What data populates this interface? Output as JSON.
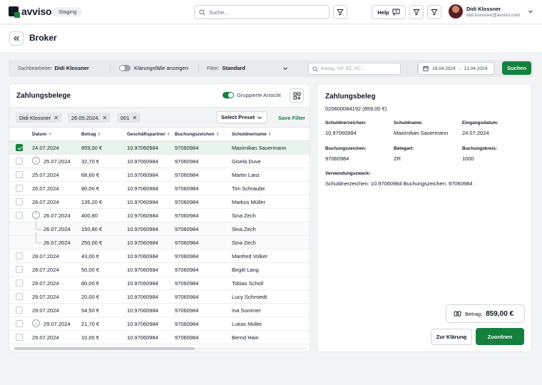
{
  "header": {
    "logo_text": "avviso",
    "env_badge": "Staging",
    "search_placeholder": "Suche...",
    "help_label": "Help",
    "user_name": "Didi Klossner",
    "user_email": "didi.klossner@avviso.com"
  },
  "page": {
    "title": "Broker"
  },
  "filterbar": {
    "clerk_label": "Sachbearbeiter",
    "clerk_value": "Didi Klossner",
    "clarification_toggle_label": "Klärungsfälle anzeigen",
    "clarification_toggle_on": false,
    "filter_label": "Filter:",
    "filter_value": "Standard",
    "search_placeholder": "Betrag, GP, BZ, SC...",
    "date_from": "18.04.2024",
    "date_sep": "-",
    "date_to": "21.04.2024",
    "search_button": "Suchen"
  },
  "left": {
    "title": "Zahlungsbelege",
    "grouped_label": "Gruppierte Ansicht",
    "grouped_on": true,
    "chips": [
      "Didi Klossner",
      "26.05.2024.",
      "001"
    ],
    "preset_label": "Select Preset",
    "save_filter": "Save Filter",
    "columns": [
      "Datum",
      "Betrag",
      "Geschäftspartner",
      "Buchungszeichen",
      "Schuldnername"
    ],
    "rows": [
      {
        "date": "24.07.2024",
        "amount": "859,00 €",
        "partner": "10.97060984",
        "booking": "97060984",
        "name": "Maximilian Sauermann",
        "kind": "normal",
        "checked": true,
        "selected": true
      },
      {
        "date": "25.07.2024",
        "amount": "32,70 €",
        "partner": "10.97060984",
        "booking": "97060984",
        "name": "Gisela Duve",
        "kind": "group-collapsed",
        "checked": false,
        "selected": false
      },
      {
        "date": "25.07.2024",
        "amount": "68,60 €",
        "partner": "10.97060984",
        "booking": "97060984",
        "name": "Martin Lanz",
        "kind": "normal",
        "checked": false,
        "selected": false
      },
      {
        "date": "26.07.2024",
        "amount": "80,00 €",
        "partner": "10.97060984",
        "booking": "97060984",
        "name": "Tim Schraube",
        "kind": "normal",
        "checked": false,
        "selected": false
      },
      {
        "date": "26.07.2024",
        "amount": "135,20 €",
        "partner": "10.97060984",
        "booking": "97060984",
        "name": "Markus Müller",
        "kind": "normal",
        "checked": false,
        "selected": false
      },
      {
        "date": "26.07.2024",
        "amount": "400,80",
        "partner": "10.97060984",
        "booking": "97060984",
        "name": "Sina Zech",
        "kind": "group-expanded",
        "checked": false,
        "selected": false
      },
      {
        "date": "26.07.2024",
        "amount": "150,80 €",
        "partner": "10.97060984",
        "booking": "97060984",
        "name": "Sina Zech",
        "kind": "child",
        "checked": false,
        "selected": false
      },
      {
        "date": "26.07.2024",
        "amount": "250,00 €",
        "partner": "10.97060984",
        "booking": "97060984",
        "name": "Sina Zech",
        "kind": "child-last",
        "checked": false,
        "selected": false
      },
      {
        "date": "28.07.2024",
        "amount": "43,00 €",
        "partner": "10.97060984",
        "booking": "97060984",
        "name": "Manfred Volker",
        "kind": "normal",
        "checked": false,
        "selected": false
      },
      {
        "date": "28.07.2024",
        "amount": "50,00 €",
        "partner": "10.97060984",
        "booking": "97060984",
        "name": "Birgitt Lang",
        "kind": "normal",
        "checked": false,
        "selected": false
      },
      {
        "date": "29.07.2024",
        "amount": "80,00 €",
        "partner": "10.97060984",
        "booking": "97060984",
        "name": "Tobias Scholl",
        "kind": "normal",
        "checked": false,
        "selected": false
      },
      {
        "date": "29.07.2024",
        "amount": "20,00 €",
        "partner": "10.97060984",
        "booking": "97060984",
        "name": "Lucy Schmiedt",
        "kind": "normal",
        "checked": false,
        "selected": false
      },
      {
        "date": "29.07.2024",
        "amount": "54,50 €",
        "partner": "10.97060984",
        "booking": "97060984",
        "name": "Ina Sommer",
        "kind": "normal",
        "checked": false,
        "selected": false
      },
      {
        "date": "29.07.2024",
        "amount": "21,70 €",
        "partner": "10.97060984",
        "booking": "97060984",
        "name": "Lukas Müller",
        "kind": "group-collapsed",
        "checked": false,
        "selected": false
      },
      {
        "date": "29.07.2024",
        "amount": "10,00 €",
        "partner": "10.97060984",
        "booking": "97060984",
        "name": "Bernd Hain",
        "kind": "normal",
        "checked": false,
        "selected": false
      }
    ]
  },
  "right": {
    "title": "Zahlungsbeleg",
    "subtitle": "020600084192 (859,00 €)",
    "fields": {
      "schuldnerzeichen_label": "Schuldnerzeichen:",
      "schuldnerzeichen_value": "10.97060984",
      "schuldname_label": "Schuldname:",
      "schuldname_value": "Maximilian Sauermann",
      "eingangsdatum_label": "Eingangsdatum:",
      "eingangsdatum_value": "24.07.2024",
      "buchungszeichen_label": "Buchungszeichen:",
      "buchungszeichen_value": "97060984",
      "belegart_label": "Belegart:",
      "belegart_value": "ZR",
      "buchungskreis_label": "Buchungskreis:",
      "buchungskreis_value": "1000",
      "verwendungszweck_label": "Verwendungszweck:",
      "verwendungszweck_value": "Schuldnerzeichen: 10.97060984 Buchungszeichen: 97060984"
    },
    "amount_label": "Betrag:",
    "amount_value": "859,00 €",
    "clarify_button": "Zur Klärung",
    "assign_button": "Zuordnen"
  },
  "colors": {
    "accent": "#15803d",
    "selected_row": "#e8f3ea"
  }
}
